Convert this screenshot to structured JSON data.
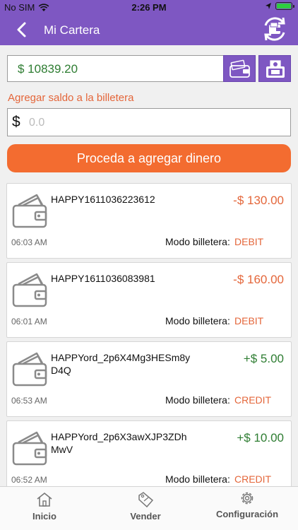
{
  "status_bar": {
    "carrier": "No SIM",
    "time": "2:26 PM"
  },
  "header": {
    "title": "Mi Cartera",
    "back_icon": "chevron-left-icon",
    "refresh_icon": "wallet-refresh-icon"
  },
  "balance": {
    "value": "$ 10839.20"
  },
  "add_funds": {
    "label": "Agregar saldo a la billetera",
    "currency": "$",
    "placeholder": "0.0",
    "value": "",
    "button_label": "Proceda a agregar dinero"
  },
  "transactions": [
    {
      "reference": "HAPPY1611036223612",
      "amount": "-$ 130.00",
      "time": "06:03 AM",
      "mode_label": "Modo billetera:",
      "mode": "DEBIT"
    },
    {
      "reference": "HAPPY1611036083981",
      "amount": "-$ 160.00",
      "time": "06:01 AM",
      "mode_label": "Modo billetera:",
      "mode": "DEBIT"
    },
    {
      "reference": "HAPPYord_2p6X4Mg3HESm8yD4Q",
      "amount": "+$ 5.00",
      "time": "06:53 AM",
      "mode_label": "Modo billetera:",
      "mode": "CREDIT"
    },
    {
      "reference": "HAPPYord_2p6X3awXJP3ZDhMwV",
      "amount": "+$ 10.00",
      "time": "06:52 AM",
      "mode_label": "Modo billetera:",
      "mode": "CREDIT"
    }
  ],
  "tabs": [
    {
      "label": "Inicio",
      "icon": "home-icon"
    },
    {
      "label": "Vender",
      "icon": "sale-tag-icon"
    },
    {
      "label": "Configuración",
      "icon": "gear-icon"
    }
  ],
  "colors": {
    "brand": "#7e57c2",
    "accent": "#f36c30",
    "debit": "#e4663a",
    "credit": "#2e7d32"
  }
}
